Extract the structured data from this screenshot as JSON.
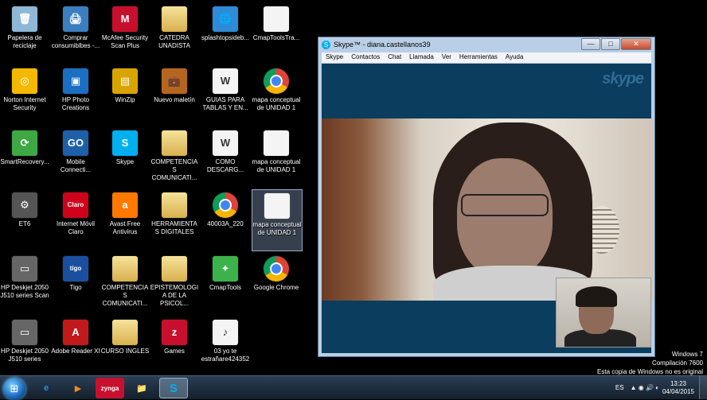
{
  "desktop_icons": [
    {
      "label": "Papelera de reciclaje",
      "glyph": "🗑",
      "color": "#8fb7d6"
    },
    {
      "label": "Comprar consumiblbes -...",
      "glyph": "🖨",
      "color": "#3b7fc0"
    },
    {
      "label": "McAfee Security Scan Plus",
      "glyph": "M",
      "color": "#c8102e"
    },
    {
      "label": "CATEDRA UNADISTA",
      "glyph": "",
      "color": "folder"
    },
    {
      "label": "splashtopsideb...",
      "glyph": "🌐",
      "color": "#2e8bd8"
    },
    {
      "label": "CmapToolsTra...",
      "glyph": "",
      "color": "doc"
    },
    {
      "label": "Norton Internet Security",
      "glyph": "◎",
      "color": "#f5b800"
    },
    {
      "label": "HP Photo Creations",
      "glyph": "▣",
      "color": "#1a6fc2"
    },
    {
      "label": "WinZip",
      "glyph": "▤",
      "color": "#d9a400"
    },
    {
      "label": "Nuevo maletín",
      "glyph": "💼",
      "color": "#b5651d"
    },
    {
      "label": "GUIAS PARA TABLAS Y EN...",
      "glyph": "W",
      "color": "doc"
    },
    {
      "label": "mapa conceptual de UNIDAD 1",
      "glyph": "",
      "color": "chrome"
    },
    {
      "label": "SmartRecovery...",
      "glyph": "⟳",
      "color": "#3da844"
    },
    {
      "label": "Mobile Connecti...",
      "glyph": "GO",
      "color": "#1d5fa8"
    },
    {
      "label": "Skype",
      "glyph": "S",
      "color": "#00aff0"
    },
    {
      "label": "COMPETENCIAS COMUNICATI...",
      "glyph": "",
      "color": "folder"
    },
    {
      "label": "COMO DESCARG...",
      "glyph": "W",
      "color": "doc"
    },
    {
      "label": "mapa conceptual de UNIDAD 1",
      "glyph": "",
      "color": "doc"
    },
    {
      "label": "ET6",
      "glyph": "⚙",
      "color": "#555"
    },
    {
      "label": "Internet Móvil Claro",
      "glyph": "Claro",
      "color": "#d0021b"
    },
    {
      "label": "Avast Free Antivirus",
      "glyph": "a",
      "color": "#ff7800"
    },
    {
      "label": "HERRAMIENTAS DIGITALES",
      "glyph": "",
      "color": "folder"
    },
    {
      "label": "40003A_220",
      "glyph": "",
      "color": "chrome"
    },
    {
      "label": "mapa conceptual de UNIDAD 1",
      "glyph": "",
      "color": "doc"
    },
    {
      "label": "HP Deskjet 2050 J510 series Scan",
      "glyph": "▭",
      "color": "#666"
    },
    {
      "label": "Tigo",
      "glyph": "tigo",
      "color": "#1a4fa0"
    },
    {
      "label": "COMPETENCIAS COMUNICATI...",
      "glyph": "",
      "color": "folder"
    },
    {
      "label": "EPISTEMOLOGIA DE LA PSICOL...",
      "glyph": "",
      "color": "folder"
    },
    {
      "label": "CmapTools",
      "glyph": "✦",
      "color": "#3bb34a"
    },
    {
      "label": "Google Chrome",
      "glyph": "",
      "color": "chrome"
    },
    {
      "label": "HP Deskjet 2050 J510 series",
      "glyph": "▭",
      "color": "#666"
    },
    {
      "label": "Adobe Reader XI",
      "glyph": "A",
      "color": "#c21a1a"
    },
    {
      "label": "CURSO INGLES",
      "glyph": "",
      "color": "folder"
    },
    {
      "label": "Games",
      "glyph": "z",
      "color": "#c8102e"
    },
    {
      "label": "03 yo te estrañare424352",
      "glyph": "♪",
      "color": "doc"
    }
  ],
  "skype": {
    "title": "Skype™ - diana.castellanos39",
    "icon": "S",
    "menu": [
      "Skype",
      "Contactos",
      "Chat",
      "Llamada",
      "Ver",
      "Herramientas",
      "Ayuda"
    ],
    "logo": "skype",
    "btn_min": "—",
    "btn_max": "□",
    "btn_close": "✕"
  },
  "watermark": {
    "line1": "Windows 7",
    "line2": "Compilación  7600",
    "line3": "Esta copia de Windows no es original"
  },
  "taskbar": {
    "start_glyph": "⊞",
    "buttons": [
      {
        "name": "ie",
        "glyph": "e",
        "color": "#2b8fe0"
      },
      {
        "name": "media-player",
        "glyph": "▶",
        "color": "#f08c1e"
      },
      {
        "name": "zynga",
        "glyph": "zynga",
        "color": "#c8102e"
      },
      {
        "name": "explorer",
        "glyph": "📁",
        "color": "#e8c35a"
      },
      {
        "name": "skype",
        "glyph": "S",
        "color": "#00aff0"
      }
    ],
    "lang": "ES",
    "tray_icons": "▲ ◉ 🔊 ◐",
    "time": "13:23",
    "date": "04/04/2015"
  }
}
